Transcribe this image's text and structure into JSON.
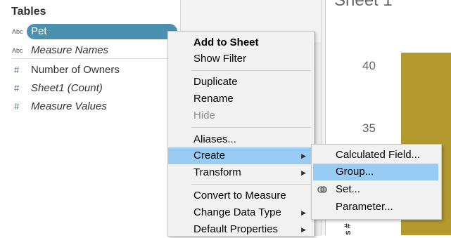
{
  "data_pane": {
    "heading": "Tables",
    "fields": [
      {
        "type": "Abc",
        "name": "Pet"
      },
      {
        "type": "Abc",
        "name": "Measure Names"
      },
      {
        "type": "#",
        "name": "Number of Owners"
      },
      {
        "type": "#",
        "name": "Sheet1 (Count)"
      },
      {
        "type": "#",
        "name": "Measure Values"
      }
    ]
  },
  "viz": {
    "sheet_title": "Sheet 1",
    "ticks": [
      "40",
      "35"
    ],
    "axis_label": "s #",
    "bar_color": "#b3992e"
  },
  "context_menu": {
    "items": [
      {
        "label": "Add to Sheet"
      },
      {
        "label": "Show Filter"
      },
      {
        "label": "Duplicate"
      },
      {
        "label": "Rename"
      },
      {
        "label": "Hide"
      },
      {
        "label": "Aliases..."
      },
      {
        "label": "Create"
      },
      {
        "label": "Transform"
      },
      {
        "label": "Convert to Measure"
      },
      {
        "label": "Change Data Type"
      },
      {
        "label": "Default Properties"
      }
    ]
  },
  "submenu": {
    "items": [
      {
        "label": "Calculated Field..."
      },
      {
        "label": "Group..."
      },
      {
        "label": "Set..."
      },
      {
        "label": "Parameter..."
      }
    ]
  },
  "colors": {
    "selected_pill": "#4a91b0",
    "menu_highlight": "#99ccf4"
  }
}
